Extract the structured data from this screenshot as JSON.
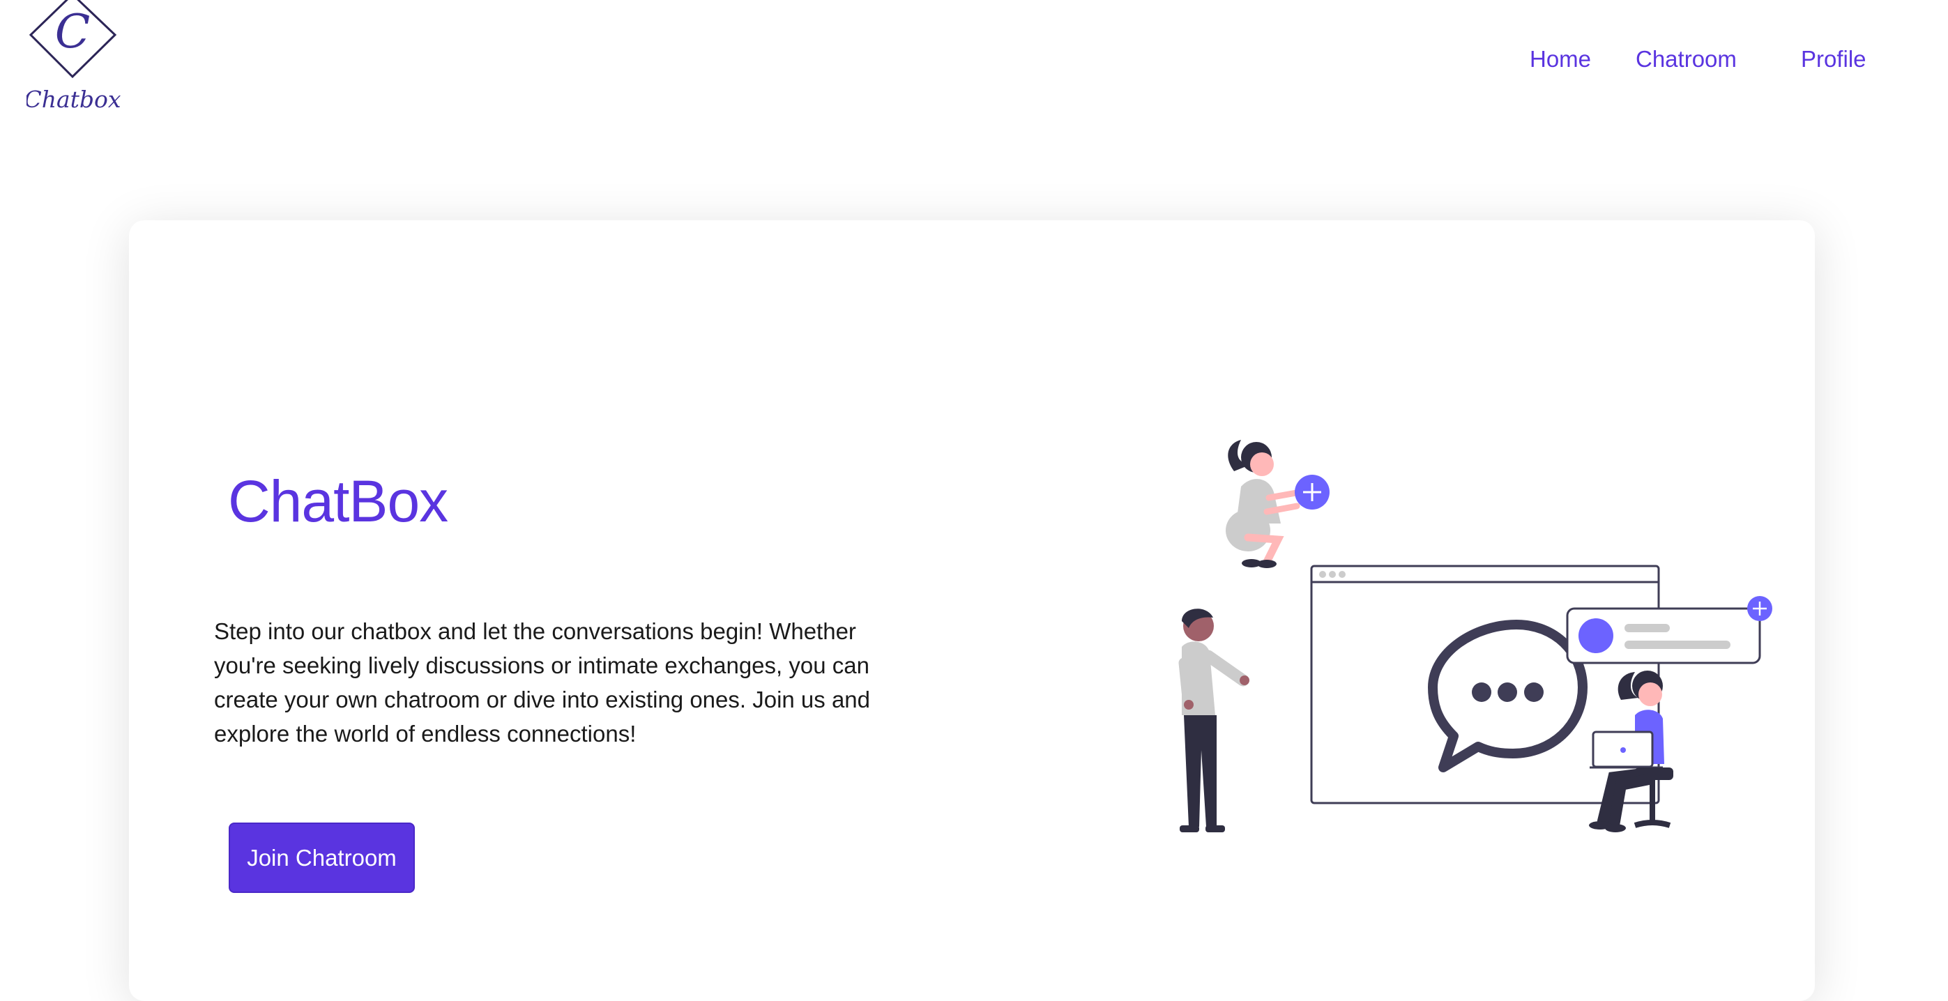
{
  "navbar": {
    "logo_letter": "C",
    "logo_text": "Chatbox",
    "links": [
      {
        "label": "Home"
      },
      {
        "label": "Chatroom"
      },
      {
        "label": "Profile"
      }
    ]
  },
  "hero": {
    "title": "ChatBox",
    "description": "Step into our chatbox and let the conversations begin! Whether you're seeking lively discussions or intimate exchanges, you can create your own chatroom or dive into existing ones. Join us and explore the world of endless connections!",
    "join_button": "Join Chatroom"
  },
  "colors": {
    "accent": "#5a34e0",
    "illustration_accent": "#6c63ff",
    "illustration_dark": "#3f3d56",
    "illustration_gray": "#cccccc"
  }
}
